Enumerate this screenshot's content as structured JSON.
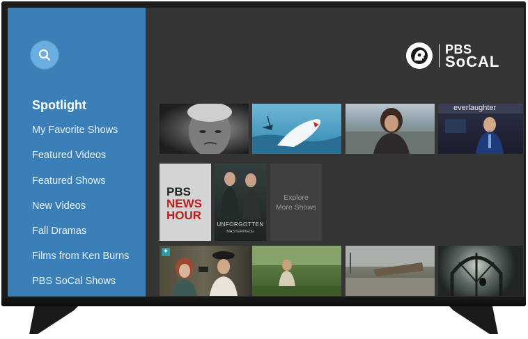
{
  "sidebar": {
    "items": [
      {
        "label": "Spotlight",
        "active": true
      },
      {
        "label": "My Favorite Shows"
      },
      {
        "label": "Featured Videos"
      },
      {
        "label": "Featured Shows"
      },
      {
        "label": "New Videos"
      },
      {
        "label": "Fall Dramas"
      },
      {
        "label": "Films from Ken Burns"
      },
      {
        "label": "PBS SoCal Shows"
      }
    ]
  },
  "logo": {
    "line1": "PBS",
    "line2": "SoCAL"
  },
  "tiles": {
    "newshour": {
      "line1": "PBS",
      "line2": "NEWS",
      "line3": "HOUR"
    },
    "unforgotten": {
      "title": "UNFORGOTTEN",
      "subtitle": "MASTERPIECE"
    },
    "explore": {
      "label": "Explore More Shows"
    },
    "laughter": {
      "text": "everlaughter"
    }
  },
  "colors": {
    "sidebar": "#3a7fb8",
    "search_button": "#6aaee0",
    "screen_bg": "#353535",
    "newshour_red": "#b61d1d"
  },
  "icons": {
    "search": "search-icon",
    "logo": "pbs-head-icon"
  }
}
